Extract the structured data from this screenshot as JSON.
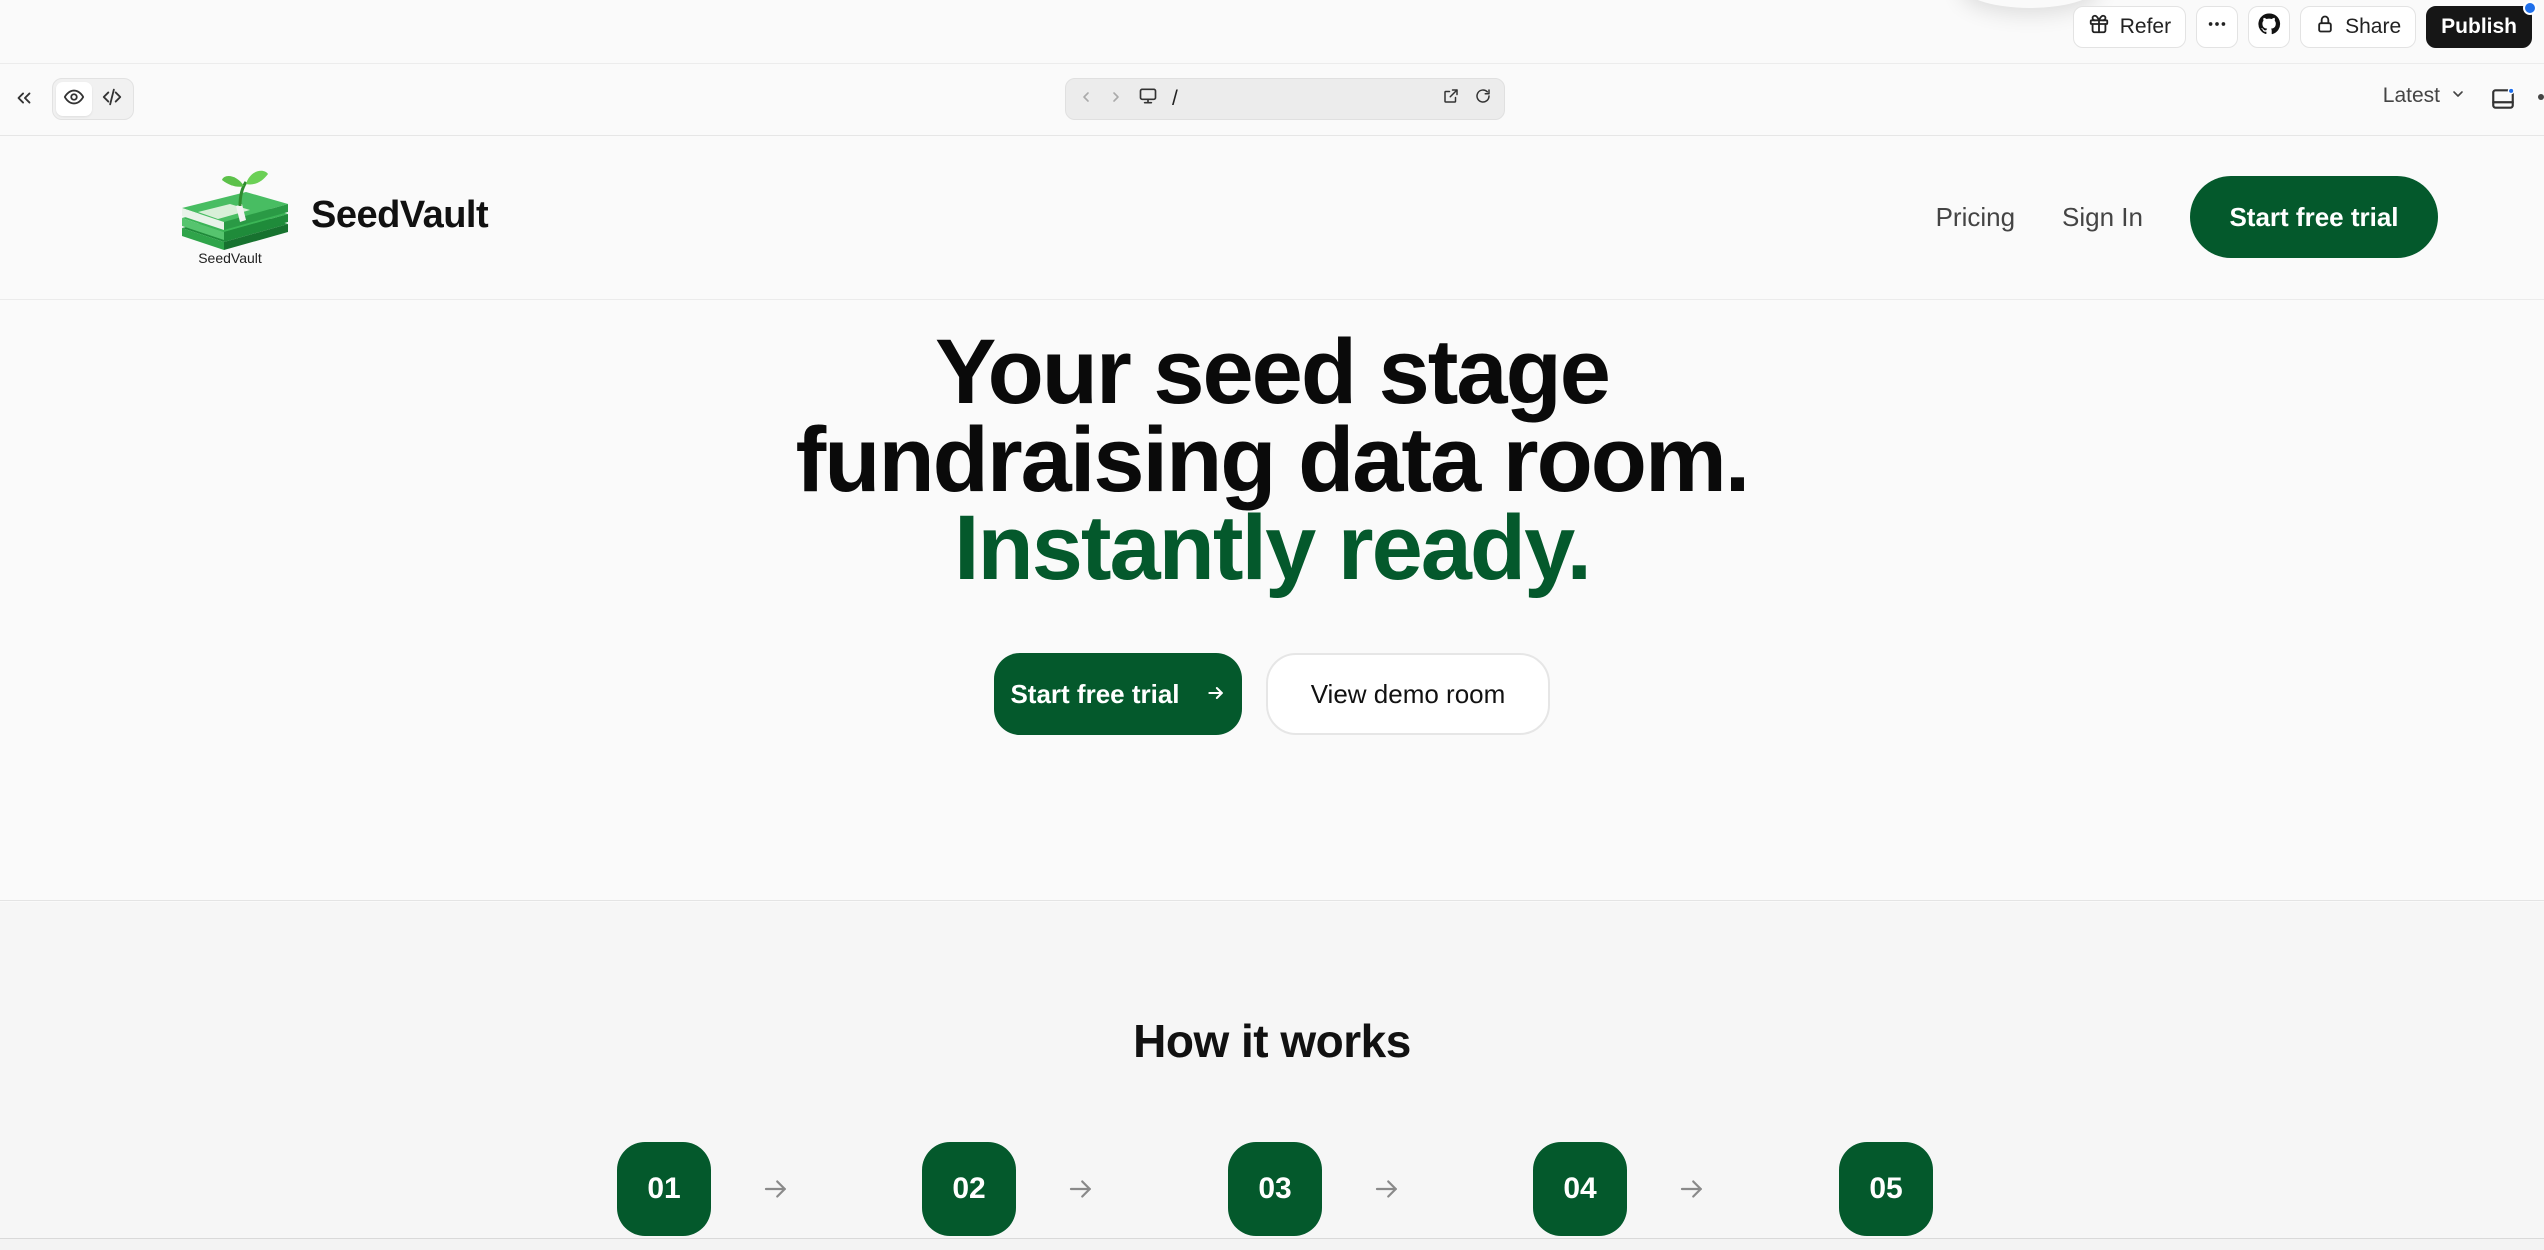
{
  "app_bar": {
    "refer_label": "Refer",
    "share_label": "Share",
    "publish_label": "Publish",
    "icons": [
      "gift-icon",
      "more-horizontal-icon",
      "github-icon",
      "lock-icon"
    ]
  },
  "toolbar": {
    "url_path": "/",
    "version_label": "Latest",
    "icons": [
      "collapse-icon",
      "eye-icon",
      "code-icon",
      "back-icon",
      "forward-icon",
      "monitor-icon",
      "open-external-icon",
      "refresh-icon",
      "chevron-down-icon",
      "layout-icon"
    ]
  },
  "site": {
    "brand": "SeedVault",
    "logo_caption": "SeedVault",
    "nav": {
      "pricing": "Pricing",
      "sign_in": "Sign In",
      "cta": "Start free trial"
    }
  },
  "hero": {
    "line1": "Your seed stage",
    "line2": "fundraising data room.",
    "line3": "Instantly ready.",
    "primary_cta": "Start free trial",
    "secondary_cta": "View demo room"
  },
  "how_it_works": {
    "title": "How it works",
    "steps": [
      "01",
      "02",
      "03",
      "04",
      "05"
    ]
  },
  "colors": {
    "brand_green": "#04592c",
    "publish_bg": "#161616",
    "notification_dot": "#1f6feb"
  }
}
